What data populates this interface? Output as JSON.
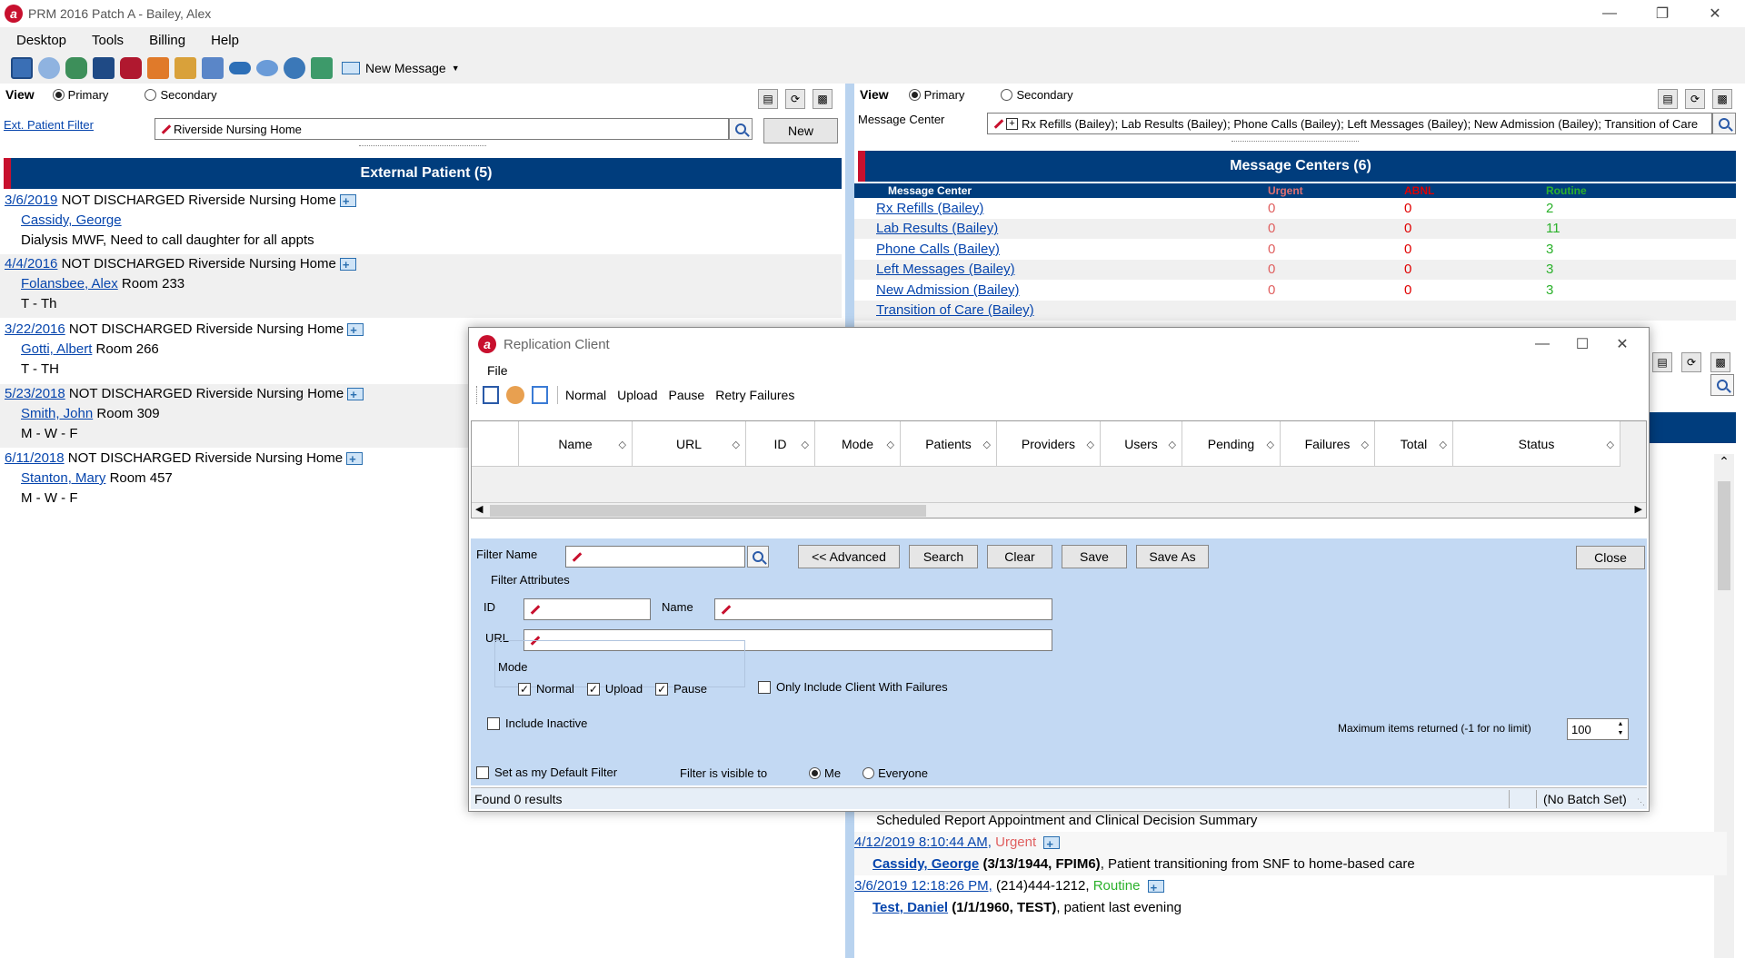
{
  "window": {
    "title": "PRM 2016 Patch A - Bailey, Alex",
    "logo": "a"
  },
  "menu": [
    "Desktop",
    "Tools",
    "Billing",
    "Help"
  ],
  "toolbar": {
    "new_message_label": "New Message",
    "icons": [
      "calendar-icon",
      "chart-icon",
      "people-icon",
      "contact-card-icon",
      "phone-icon",
      "documents-icon",
      "tasks-icon",
      "report-icon",
      "voicemail-icon",
      "chat-icon",
      "globe-icon",
      "clipboard-icon"
    ]
  },
  "left": {
    "view_label": "View",
    "primary_label": "Primary",
    "secondary_label": "Secondary",
    "filter_link": "Ext. Patient Filter",
    "filter_value": "Riverside Nursing Home",
    "new_button": "New",
    "header": "External Patient (5)",
    "patients": [
      {
        "date": "3/6/2019",
        "status": "NOT DISCHARGED Riverside Nursing Home",
        "name": "Cassidy, George",
        "extra": "",
        "note": "Dialysis MWF, Need to call daughter for all appts"
      },
      {
        "date": "4/4/2016",
        "status": "NOT DISCHARGED Riverside Nursing Home",
        "name": "Folansbee, Alex",
        "extra": "Room 233",
        "note": "T - Th"
      },
      {
        "date": "3/22/2016",
        "status": "NOT DISCHARGED Riverside Nursing Home",
        "name": "Gotti, Albert",
        "extra": "Room 266",
        "note": "T - TH"
      },
      {
        "date": "5/23/2018",
        "status": "NOT DISCHARGED Riverside Nursing Home",
        "name": "Smith, John",
        "extra": "Room 309",
        "note": "M - W - F"
      },
      {
        "date": "6/11/2018",
        "status": "NOT DISCHARGED Riverside Nursing Home",
        "name": "Stanton, Mary",
        "extra": "Room 457",
        "note": "M - W - F"
      }
    ]
  },
  "right": {
    "view_label": "View",
    "primary_label": "Primary",
    "secondary_label": "Secondary",
    "mc_label": "Message Center",
    "mc_filter_value": "Rx Refills (Bailey); Lab Results (Bailey); Phone Calls (Bailey); Left Messages (Bailey); New Admission (Bailey); Transition of Care",
    "header": "Message Centers (6)",
    "columns": {
      "name": "Message Center",
      "urgent": "Urgent",
      "abnl": "ABNL",
      "routine": "Routine"
    },
    "rows": [
      {
        "name": "Rx Refills (Bailey)",
        "urgent": "0",
        "abnl": "0",
        "routine": "2"
      },
      {
        "name": "Lab Results (Bailey)",
        "urgent": "0",
        "abnl": "0",
        "routine": "11"
      },
      {
        "name": "Phone Calls (Bailey)",
        "urgent": "0",
        "abnl": "0",
        "routine": "3"
      },
      {
        "name": "Left Messages (Bailey)",
        "urgent": "0",
        "abnl": "0",
        "routine": "3"
      },
      {
        "name": "New Admission (Bailey)",
        "urgent": "0",
        "abnl": "0",
        "routine": "3"
      },
      {
        "name": "Transition of Care (Bailey)",
        "urgent": "",
        "abnl": "",
        "routine": ""
      }
    ],
    "messages": {
      "line1": "Scheduled Report Appointment and Clinical Decision Summary",
      "m1_date": "4/12/2019 8:10:44 AM,",
      "m1_priority": "Urgent",
      "m1_patient": "Cassidy, George",
      "m1_info": "(3/13/1944, FPIM6)",
      "m1_text": ", Patient transitioning from SNF to home-based care",
      "m2_date": "3/6/2019 12:18:26 PM,",
      "m2_phone": "(214)444-1212,",
      "m2_priority": "Routine",
      "m2_patient": "Test, Daniel",
      "m2_info": "(1/1/1960, TEST)",
      "m2_text": ", patient last evening"
    }
  },
  "dialog": {
    "title": "Replication Client",
    "menu": "File",
    "toolbar": [
      "Normal",
      "Upload",
      "Pause",
      "Retry Failures"
    ],
    "columns": [
      "Name",
      "URL",
      "ID",
      "Mode",
      "Patients",
      "Providers",
      "Users",
      "Pending",
      "Failures",
      "Total",
      "Status"
    ],
    "filter": {
      "filter_name_label": "Filter Name",
      "advanced": "<< Advanced",
      "search": "Search",
      "clear": "Clear",
      "save": "Save",
      "save_as": "Save As",
      "close": "Close",
      "attributes_label": "Filter Attributes",
      "id_label": "ID",
      "name_label": "Name",
      "url_label": "URL",
      "mode_label": "Mode",
      "mode_normal": "Normal",
      "mode_upload": "Upload",
      "mode_pause": "Pause",
      "only_failures": "Only Include Client With Failures",
      "include_inactive": "Include Inactive",
      "max_items_label": "Maximum items returned (-1 for no limit)",
      "max_items_value": "100",
      "default_filter": "Set as my Default Filter",
      "visible_to": "Filter is visible to",
      "me": "Me",
      "everyone": "Everyone"
    },
    "status": {
      "found": "Found 0 results",
      "batch": "(No Batch Set)"
    }
  },
  "colors": {
    "header_blue": "#003d7d",
    "accent_red": "#c8102e",
    "filter_bg": "#c3d9f3",
    "routine_green": "#2bb12b",
    "urgent_red": "#e06060"
  }
}
